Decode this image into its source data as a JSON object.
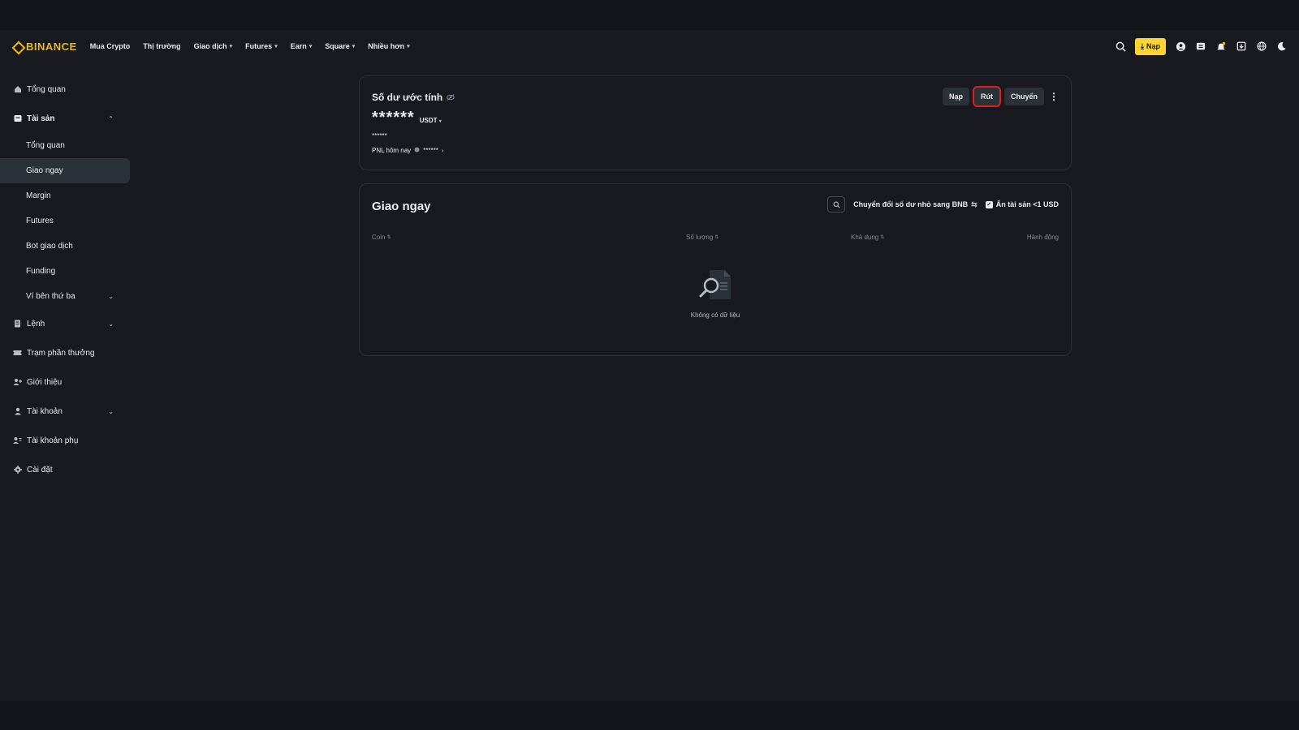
{
  "brand": "BINANCE",
  "nav": {
    "items": [
      {
        "label": "Mua Crypto",
        "caret": false
      },
      {
        "label": "Thị trường",
        "caret": false
      },
      {
        "label": "Giao dịch",
        "caret": true
      },
      {
        "label": "Futures",
        "caret": true
      },
      {
        "label": "Earn",
        "caret": true
      },
      {
        "label": "Square",
        "caret": true
      },
      {
        "label": "Nhiều hơn",
        "caret": true
      }
    ],
    "deposit_label": "Nạp"
  },
  "sidebar": {
    "overview": "Tổng quan",
    "assets": "Tài sản",
    "assets_children": [
      "Tổng quan",
      "Giao ngay",
      "Margin",
      "Futures",
      "Bot giao dịch",
      "Funding",
      "Ví bên thứ ba"
    ],
    "orders": "Lệnh",
    "rewards": "Trạm phần thưởng",
    "referral": "Giới thiệu",
    "account": "Tài khoản",
    "subaccount": "Tài khoản phụ",
    "settings": "Cài đặt",
    "active_item": "Giao ngay"
  },
  "balance": {
    "title": "Số dư ước tính",
    "amount": "******",
    "unit": "USDT",
    "sub_amount": "******",
    "pnl_label": "PNL hôm nay",
    "pnl_value": "******",
    "actions": {
      "deposit": "Nạp",
      "withdraw": "Rút",
      "transfer": "Chuyển"
    }
  },
  "spot": {
    "title": "Giao ngay",
    "convert_label": "Chuyển đổi số dư nhỏ sang BNB",
    "hide_small_label": "Ẩn tài sản <1 USD",
    "hide_small_checked": true,
    "columns": {
      "coin": "Coin",
      "amount": "Số lượng",
      "available": "Khả dụng",
      "action": "Hành động"
    },
    "empty_text": "Không có dữ liệu"
  },
  "colors": {
    "background": "#181a20",
    "accent": "#f0b90b",
    "highlight": "#e0201b"
  }
}
